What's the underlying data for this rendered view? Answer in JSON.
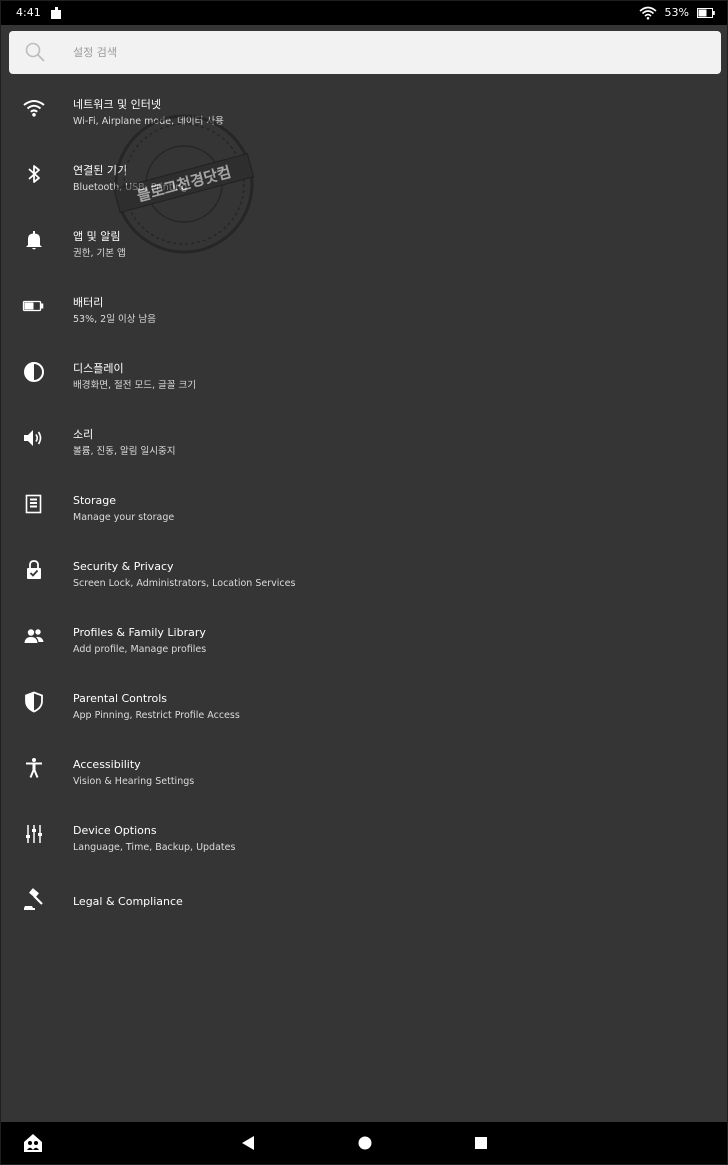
{
  "status_bar": {
    "time": "4:41",
    "battery_percent": "53%",
    "left_icon": "notification-icon",
    "wifi_icon": "wifi-icon",
    "battery_icon": "battery-icon"
  },
  "search": {
    "placeholder": "설정 검색",
    "icon": "search-icon"
  },
  "settings_items": [
    {
      "icon": "wifi-icon",
      "title": "네트워크 및 인터넷",
      "subtitle": "Wi-Fi, Airplane mode, 데이터 사용"
    },
    {
      "icon": "bluetooth-icon",
      "title": "연결된 기기",
      "subtitle": "Bluetooth, USB, Printing"
    },
    {
      "icon": "bell-icon",
      "title": "앱 및 알림",
      "subtitle": "권한, 기본 앱"
    },
    {
      "icon": "battery-icon",
      "title": "배터리",
      "subtitle": "53%, 2일 이상 남음"
    },
    {
      "icon": "contrast-icon",
      "title": "디스플레이",
      "subtitle": "배경화면, 절전 모드, 글꼴 크기"
    },
    {
      "icon": "speaker-icon",
      "title": "소리",
      "subtitle": "볼륨, 진동, 알림 일시중지"
    },
    {
      "icon": "storage-icon",
      "title": "Storage",
      "subtitle": "Manage your storage"
    },
    {
      "icon": "lock-icon",
      "title": "Security & Privacy",
      "subtitle": "Screen Lock, Administrators, Location Services"
    },
    {
      "icon": "profiles-icon",
      "title": "Profiles & Family Library",
      "subtitle": "Add profile, Manage profiles"
    },
    {
      "icon": "shield-icon",
      "title": "Parental Controls",
      "subtitle": "App Pinning, Restrict Profile Access"
    },
    {
      "icon": "accessibility-icon",
      "title": "Accessibility",
      "subtitle": "Vision & Hearing Settings"
    },
    {
      "icon": "sliders-icon",
      "title": "Device Options",
      "subtitle": "Language, Time, Backup, Updates"
    },
    {
      "icon": "gavel-icon",
      "title": "Legal & Compliance",
      "subtitle": ""
    }
  ],
  "watermark": {
    "icon": "watermark-stamp-icon",
    "text": "블로그천경닷컴"
  },
  "nav_bar": {
    "home_profile_icon": "home-profile-icon",
    "back_icon": "back-icon",
    "home_icon": "home-icon",
    "recents_icon": "recents-icon"
  },
  "colors": {
    "background": "#353535",
    "status_bar": "#000000",
    "search_bg": "#f2f2f2",
    "text_primary": "#ffffff",
    "text_secondary": "#dcdcdc"
  }
}
